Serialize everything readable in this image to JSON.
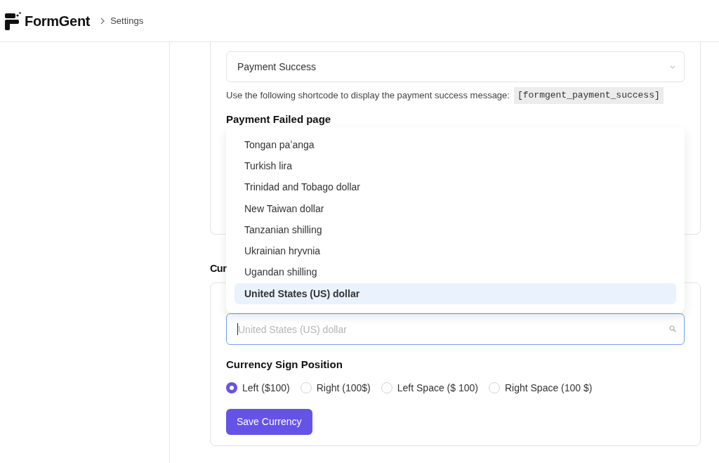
{
  "header": {
    "brand": "FormGent",
    "breadcrumb": "Settings"
  },
  "payment_pages": {
    "success_select": {
      "value": "Payment Success"
    },
    "shortcode_help": {
      "text": "Use the following shortcode to display the payment success message:",
      "code": "[formgent_payment_success]"
    },
    "failed_label": "Payment Failed page"
  },
  "currency_dropdown": {
    "options": [
      {
        "label": "Tongan paʻanga",
        "selected": false
      },
      {
        "label": "Turkish lira",
        "selected": false
      },
      {
        "label": "Trinidad and Tobago dollar",
        "selected": false
      },
      {
        "label": "New Taiwan dollar",
        "selected": false
      },
      {
        "label": "Tanzanian shilling",
        "selected": false
      },
      {
        "label": "Ukrainian hryvnia",
        "selected": false
      },
      {
        "label": "Ugandan shilling",
        "selected": false
      },
      {
        "label": "United States (US) dollar",
        "selected": true
      }
    ]
  },
  "currency_section": {
    "heading": "Cur",
    "search": {
      "placeholder": "United States (US) dollar",
      "focused": true
    },
    "sign_position": {
      "label": "Currency Sign Position",
      "options": [
        {
          "label": "Left ($100)",
          "selected": true
        },
        {
          "label": "Right (100$)",
          "selected": false
        },
        {
          "label": "Left Space ($ 100)",
          "selected": false
        },
        {
          "label": "Right Space (100 $)",
          "selected": false
        }
      ]
    },
    "save_button": "Save Currency"
  }
}
